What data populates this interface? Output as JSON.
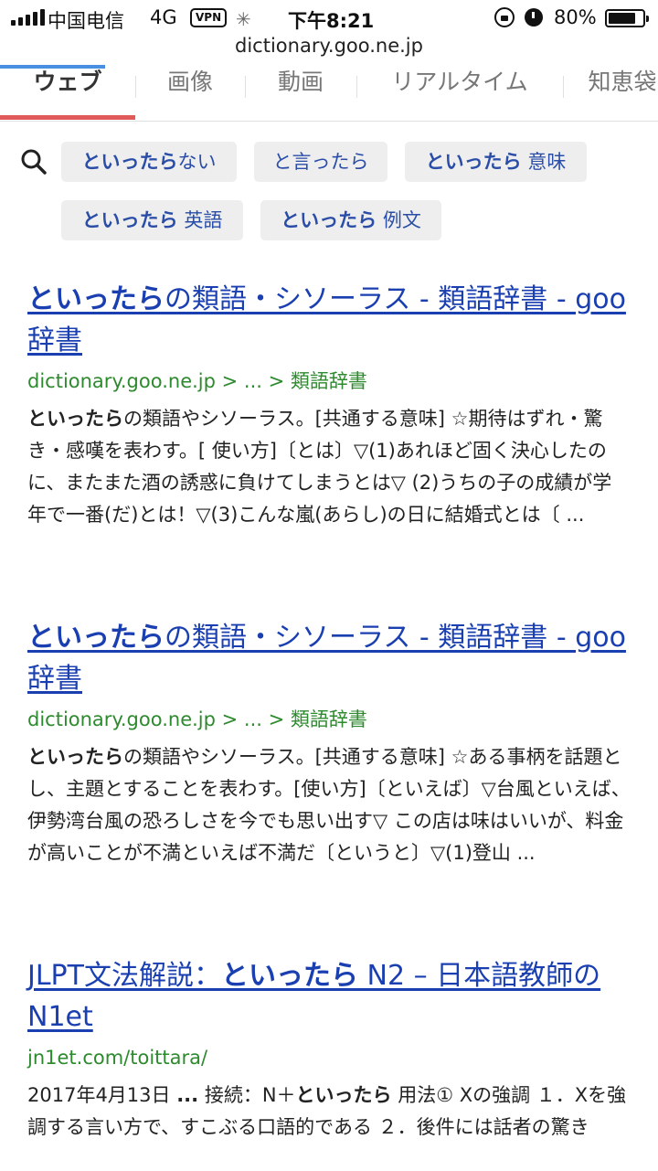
{
  "status": {
    "carrier": "中国电信",
    "network": "4G",
    "vpn": "VPN",
    "time": "下午8:21",
    "battery_pct": "80%",
    "battery_level": 0.8
  },
  "browser": {
    "url": "dictionary.goo.ne.jp",
    "load_progress": 0.16
  },
  "tabs": [
    {
      "label": "ウェブ",
      "active": true
    },
    {
      "label": "画像",
      "active": false
    },
    {
      "label": "動画",
      "active": false
    },
    {
      "label": "リアルタイム",
      "active": false
    },
    {
      "label": "知恵袋",
      "active": false
    }
  ],
  "suggestions": [
    {
      "bold": "といったら",
      "rest": "ない"
    },
    {
      "bold": "",
      "rest": "と言ったら"
    },
    {
      "bold": "といったら",
      "rest": " 意味"
    },
    {
      "bold": "といったら",
      "rest": " 英語"
    },
    {
      "bold": "といったら",
      "rest": " 例文"
    }
  ],
  "results": [
    {
      "title_bold": "といったら",
      "title_rest": "の類語・シソーラス - 類語辞書 - goo辞書",
      "url": "dictionary.goo.ne.jp > ... > 類語辞書",
      "snippet_bold": "といったら",
      "snippet_rest": "の類語やシソーラス。[共通する意味] ☆期待はずれ・驚き・感嘆を表わす。[ 使い方]〔とは〕▽(1)あれほど固く決心したのに、またまた酒の誘惑に負けてしまうとは▽ (2)うちの子の成績が学年で一番(だ)とは！▽(3)こんな嵐(あらし)の日に結婚式とは〔 ..."
    },
    {
      "title_bold": "といったら",
      "title_rest": "の類語・シソーラス - 類語辞書 - goo辞書",
      "url": "dictionary.goo.ne.jp > ... > 類語辞書",
      "snippet_bold": "といったら",
      "snippet_rest": "の類語やシソーラス。[共通する意味] ☆ある事柄を話題とし、主題とすることを表わす。[使い方]〔といえば〕▽台風といえば、伊勢湾台風の恐ろしさを今でも思い出す▽ この店は味はいいが、料金が高いことが不満といえば不満だ〔というと〕▽(1)登山 ..."
    },
    {
      "title_pre": "JLPT文法解説：",
      "title_bold": "といったら",
      "title_rest": " N2 – 日本語教師のN1et",
      "url": "jn1et.com/toittara/",
      "snippet_pre": "2017年4月13日 ",
      "snippet_dots": "...",
      "snippet_mid": " 接続：N＋",
      "snippet_bold": "といったら",
      "snippet_rest": " 用法① Xの強調 １．Xを強調する言い方で、すこぶる口語的である ２．後件には話者の驚き"
    }
  ]
}
